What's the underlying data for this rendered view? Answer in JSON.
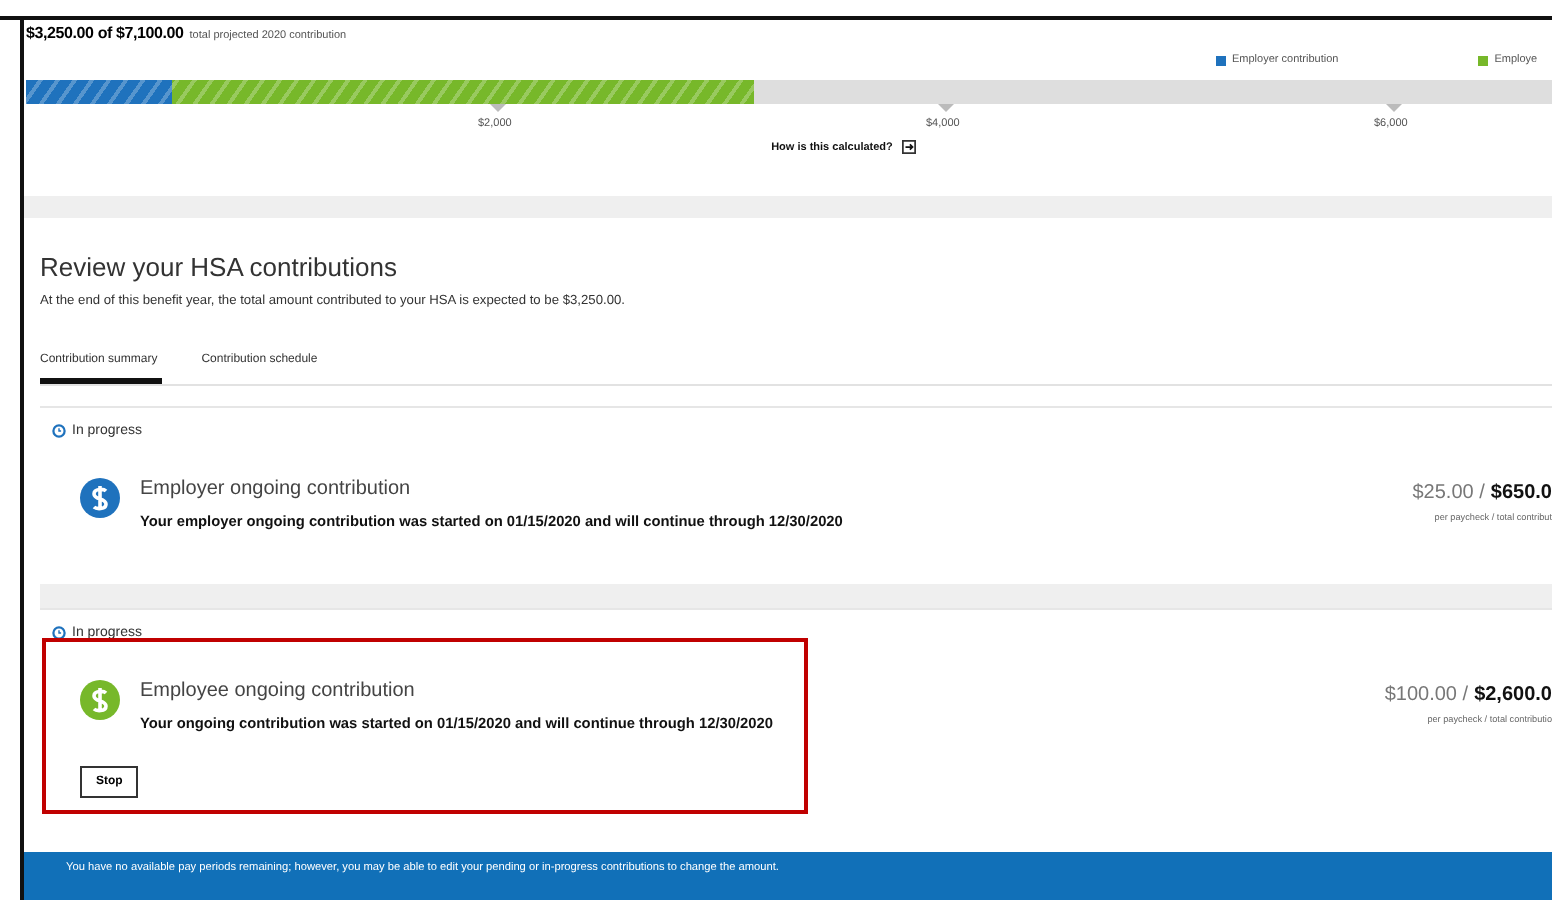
{
  "summary": {
    "amount": "$3,250.00 of $7,100.00",
    "caption": "total projected 2020 contribution"
  },
  "progress": {
    "segments": [
      {
        "name": "Employer contribution",
        "color": "#1f72bd",
        "level": 0.0955
      },
      {
        "name": "Employe",
        "color": "#77b82a",
        "level": 0.4777
      }
    ],
    "scale_labels": [
      "$2,000",
      "$4,000",
      "$6,000"
    ]
  },
  "calc_link": "How is this calculated?",
  "heading": "Review your HSA contributions",
  "subtitle": "At the end of this benefit year, the total amount contributed to your HSA is expected to be $3,250.00.",
  "tabs": [
    {
      "label": "Contribution summary",
      "selected": true
    },
    {
      "label": "Contribution schedule",
      "selected": false
    }
  ],
  "cards": [
    {
      "status": "In progress",
      "title": "Employer ongoing contribution",
      "description": "Your employer ongoing contribution was started on 01/15/2020 and will continue through 12/30/2020",
      "per_paycheck": "$25.00 /",
      "total": "$650.0",
      "amount_caption": "per paycheck / total contribut",
      "color": "#1f72bd",
      "highlighted": false
    },
    {
      "status": "In progress",
      "title": "Employee ongoing contribution",
      "description": "Your ongoing contribution was started on 01/15/2020 and will continue through 12/30/2020",
      "per_paycheck": "$100.00 /",
      "total": "$2,600.0",
      "amount_caption": "per paycheck / total contributio",
      "color": "#77b82a",
      "highlighted": true,
      "button": "Stop"
    }
  ],
  "banner": "You have no available pay periods remaining; however, you may be able to edit your pending or in-progress contributions to change the amount."
}
